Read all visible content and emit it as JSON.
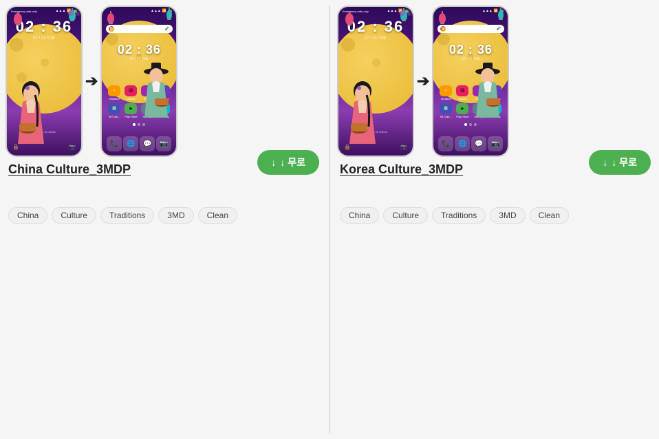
{
  "cards": [
    {
      "id": "china",
      "title": "China Culture_3MDP",
      "download_label": "↓ 무로",
      "tags": [
        "China",
        "Culture",
        "Traditions",
        "3MD",
        "Clean"
      ],
      "phone_left": {
        "time": "02 : 36",
        "date": "07 / 21  TUE",
        "type": "lock"
      },
      "phone_right": {
        "time": "02 : 36",
        "date": "07 / 21  TUE",
        "type": "home"
      }
    },
    {
      "id": "korea",
      "title": "Korea Culture_3MDP",
      "download_label": "↓ 무로",
      "tags": [
        "China",
        "Culture",
        "Traditions",
        "3MD",
        "Clean"
      ],
      "phone_left": {
        "time": "02 : 36",
        "date": "07 / 21  TUE",
        "type": "lock"
      },
      "phone_right": {
        "time": "02 : 36",
        "date": "07 / 21  TUE",
        "type": "home"
      }
    }
  ],
  "icons": {
    "download": "↓",
    "arrow": "→"
  },
  "app_icons": {
    "weather": "☀",
    "gallery": "🖼",
    "music": "🎵",
    "themes": "🔧",
    "calculator": "🔢",
    "playstore": "▶",
    "settings": "⚙",
    "security": "🛡",
    "phone": "📞",
    "browser": "🌐",
    "messages": "💬",
    "camera": "📷"
  }
}
